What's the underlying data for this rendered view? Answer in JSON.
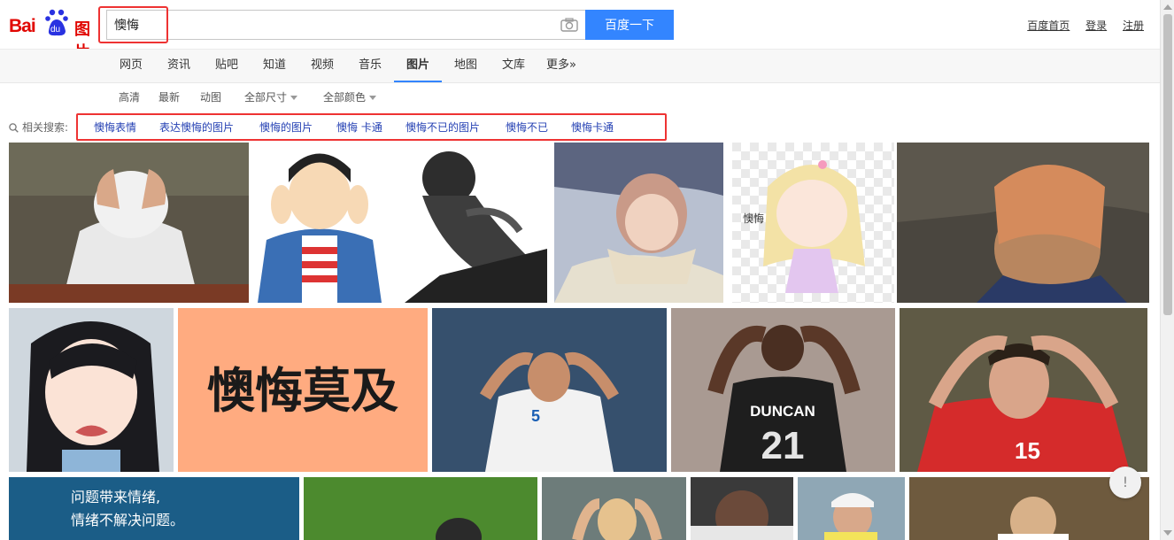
{
  "logo": {
    "text_bai": "Bai",
    "text_du": "du",
    "text_tu": "图片"
  },
  "search": {
    "query": "懊悔",
    "button_label": "百度一下"
  },
  "top_links": [
    "百度首页",
    "登录",
    "注册"
  ],
  "tabs": [
    "网页",
    "资讯",
    "贴吧",
    "知道",
    "视频",
    "音乐",
    "图片",
    "地图",
    "文库",
    "更多»"
  ],
  "filters": [
    "高清",
    "最新",
    "动图",
    "全部尺寸",
    "全部颜色"
  ],
  "related": {
    "label": "相关搜索:",
    "items": [
      "懊悔表情",
      "表达懊悔的图片",
      "懊悔的图片",
      "懊悔 卡通",
      "懊悔不已的图片",
      "懊悔不已",
      "懊悔卡通"
    ]
  },
  "image_texts": {
    "calligraphy": "懊悔莫及",
    "quote_line1": "问题带来情绪,",
    "quote_line2": "情绪不解决问题。",
    "jersey_name": "DUNCAN",
    "jersey_number": "21",
    "chibi_label": "懊悔",
    "greek_number": "5",
    "serbia_number": "15"
  },
  "feedback_icon": "!",
  "colors": {
    "accent": "#3385ff",
    "brand_red": "#e10601",
    "link": "#2440b3",
    "highlight_box": "#e33"
  }
}
